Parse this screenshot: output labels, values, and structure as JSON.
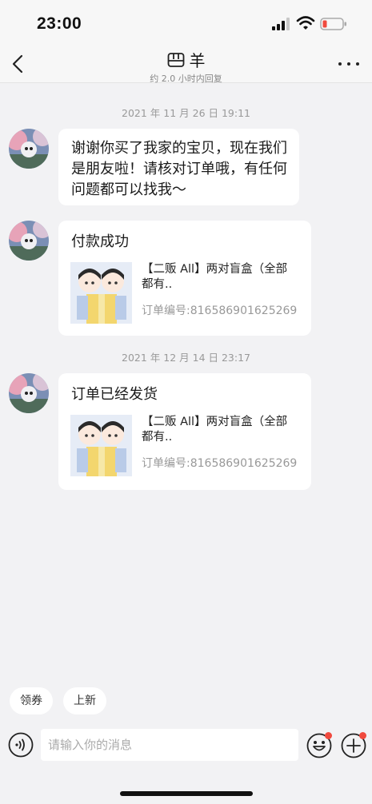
{
  "status_bar": {
    "time": "23:00"
  },
  "header": {
    "title": "羊",
    "subtitle": "约 2.0 小时内回复"
  },
  "messages": [
    {
      "timestamp": "2021 年 11 月 26 日 19:11",
      "text": "谢谢你买了我家的宝贝，现在我们是朋友啦！请核对订单哦，有任何问题都可以找我～"
    },
    {
      "title": "付款成功",
      "product_name": "【二贩 All】两对盲盒（全部都有..",
      "order_number": "订单编号:816586901625269"
    },
    {
      "timestamp": "2021 年 12 月 14 日 23:17",
      "title": "订单已经发货",
      "product_name": "【二贩 All】两对盲盒（全部都有..",
      "order_number": "订单编号:816586901625269"
    }
  ],
  "quick_actions": [
    "领券",
    "上新"
  ],
  "input": {
    "placeholder": "请输入你的消息"
  },
  "colors": {
    "badge": "#f04a3e",
    "background": "#f2f2f4",
    "bubble": "#ffffff"
  }
}
